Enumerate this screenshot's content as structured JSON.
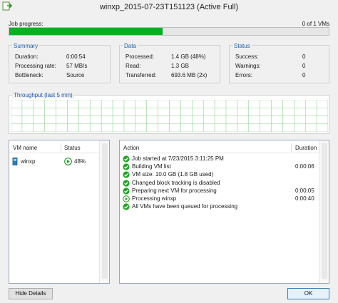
{
  "window": {
    "title": "winxp_2015-07-23T151123 (Active Full)"
  },
  "job": {
    "progress_label": "Job progress:",
    "progress_count": "0 of 1 VMs",
    "progress_fraction": 0.48
  },
  "summary": {
    "title": "Summary",
    "duration_label": "Duration:",
    "duration_value": "0:00:54",
    "rate_label": "Processing rate:",
    "rate_value": "57 MB/s",
    "bottleneck_label": "Bottleneck:",
    "bottleneck_value": "Source"
  },
  "data": {
    "title": "Data",
    "processed_label": "Processed:",
    "processed_value": "1.4 GB (48%)",
    "read_label": "Read:",
    "read_value": "1.3 GB",
    "transferred_label": "Transferred:",
    "transferred_value": "693.6 MB (2x)"
  },
  "status": {
    "title": "Status",
    "success_label": "Success:",
    "success_value": "0",
    "warnings_label": "Warnings:",
    "warnings_value": "0",
    "errors_label": "Errors:",
    "errors_value": "0"
  },
  "throughput": {
    "title": "Throughput (last 5 min)"
  },
  "vm_list": {
    "col_name": "VM name",
    "col_status": "Status",
    "rows": [
      {
        "name": "winxp",
        "status": "48%",
        "icon": "vm-server-icon",
        "status_icon": "running-icon"
      }
    ]
  },
  "actions": {
    "col_action": "Action",
    "col_duration": "Duration",
    "items": [
      {
        "text": "Job started at 7/23/2015 3:11:25 PM",
        "duration": "",
        "icon": "success-icon"
      },
      {
        "text": "Building VM list",
        "duration": "0:00:06",
        "icon": "success-icon"
      },
      {
        "text": "VM size: 10.0 GB (1.8 GB used)",
        "duration": "",
        "icon": "success-icon"
      },
      {
        "text": "Changed block tracking is disabled",
        "duration": "",
        "icon": "success-icon"
      },
      {
        "text": "Preparing next VM for processing",
        "duration": "0:00:05",
        "icon": "success-icon"
      },
      {
        "text": "Processing winxp",
        "duration": "0:00:40",
        "icon": "running-icon"
      },
      {
        "text": "All VMs have been queued for processing",
        "duration": "",
        "icon": "success-icon"
      }
    ]
  },
  "buttons": {
    "hide_details": "Hide Details",
    "ok": "OK"
  },
  "colors": {
    "progress_green": "#06b025",
    "section_title_blue": "#1e5aa8",
    "grid_green": "#8fd18f"
  }
}
